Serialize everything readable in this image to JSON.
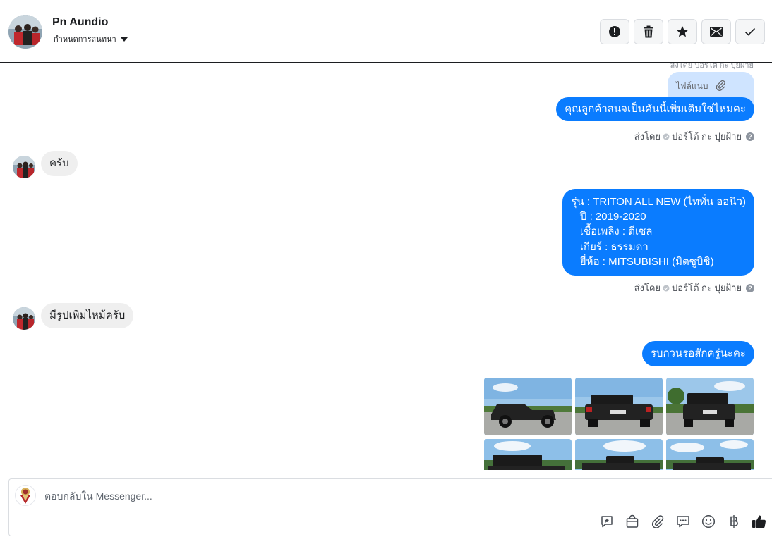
{
  "header": {
    "contact_name": "Pn Aundio",
    "assign_label": "กำหนดการสนทนา",
    "actions": [
      {
        "name": "report-button",
        "icon": "exclamation-circle-icon"
      },
      {
        "name": "delete-button",
        "icon": "trash-icon"
      },
      {
        "name": "star-button",
        "icon": "star-icon"
      },
      {
        "name": "mark-unread-button",
        "icon": "envelope-icon"
      },
      {
        "name": "mark-done-button",
        "icon": "check-icon"
      }
    ]
  },
  "messages": {
    "clipped_top_text": "ส่งโดย ปอร์โต้ กะ ปุยฝ้าย",
    "attachment_label": "ไฟล์แนบ",
    "out_1": "คุณลูกค้าสนจเป็นคันนี้เพิ่มเติมใช่ไหมคะ",
    "sent_by_1": "ส่งโดย",
    "sender_1": "ปอร์โต้ กะ ปุยฝ้าย",
    "in_1": "ครับ",
    "spec_lines": [
      "รุ่น : TRITON ALL NEW (ไททั่น ออนิว)",
      "   ปี : 2019-2020",
      "   เชื้อเพลิง : ดีเซล",
      "   เกียร์ : ธรรมดา",
      "   ยี่ห้อ : MITSUBISHI (มิตซูบิชิ)"
    ],
    "sent_by_2": "ส่งโดย",
    "sender_2": "ปอร์โต้ กะ ปุยฝ้าย",
    "in_2": "มีรูปเพิมไหม้ครับ",
    "out_3": "รบกวนรอสักครู่นะคะ",
    "photo_count": 6
  },
  "composer": {
    "placeholder": "ตอบกลับใน Messenger...",
    "value": "",
    "tools": [
      "saved-reply-icon",
      "shop-bag-icon",
      "paperclip-icon",
      "chat-bubbles-icon",
      "smiley-icon",
      "baht-icon",
      "thumbs-up-icon"
    ]
  },
  "colors": {
    "outgoing_bubble": "#0a7cff",
    "incoming_bubble": "#efefef",
    "attachment_bubble": "#cfe4ff"
  }
}
